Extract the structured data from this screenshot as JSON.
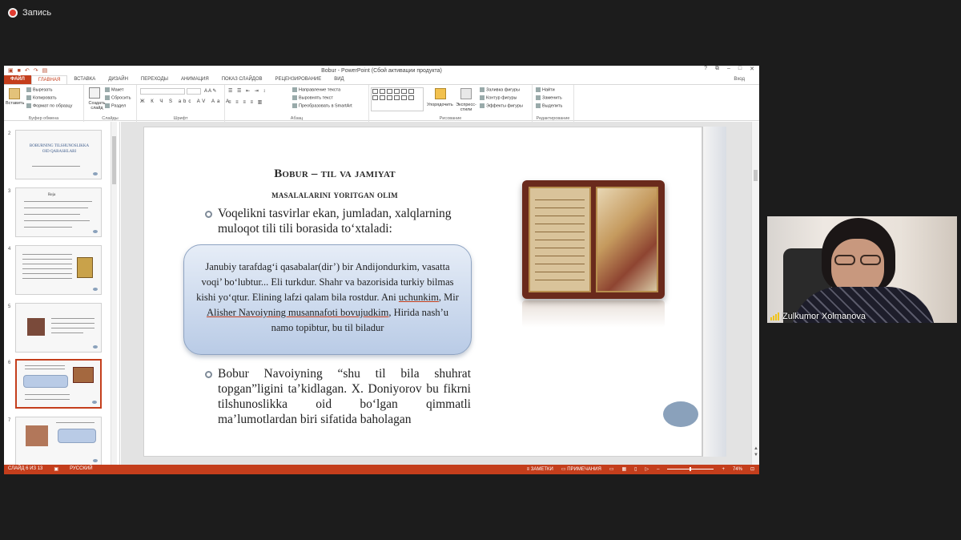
{
  "recording": {
    "label": "Запись"
  },
  "window": {
    "title": "Bobur - PowerPoint (Сбой активации продукта)",
    "controls": [
      "?",
      "⧉",
      "–",
      "□",
      "✕"
    ],
    "signin": "Вход"
  },
  "ribbon": {
    "tabs": [
      "ФАЙЛ",
      "ГЛАВНАЯ",
      "ВСТАВКА",
      "ДИЗАЙН",
      "ПЕРЕХОДЫ",
      "АНИМАЦИЯ",
      "ПОКАЗ СЛАЙДОВ",
      "РЕЦЕНЗИРОВАНИЕ",
      "ВИД"
    ],
    "clipboard": {
      "paste": "Вставить",
      "cut": "Вырезать",
      "copy": "Копировать",
      "format": "Формат по образцу",
      "label": "Буфер обмена"
    },
    "slides": {
      "new": "Создать слайд",
      "layout": "Макет",
      "reset": "Сбросить",
      "section": "Раздел",
      "label": "Слайды"
    },
    "font": {
      "label": "Шрифт"
    },
    "paragraph": {
      "direction": "Направление текста",
      "align": "Выровнять текст",
      "smartart": "Преобразовать в SmartArt",
      "label": "Абзац"
    },
    "drawing": {
      "arrange": "Упорядочить",
      "styles": "Экспресс-стили",
      "fill": "Заливка фигуры",
      "outline": "Контур фигуры",
      "effects": "Эффекты фигуры",
      "label": "Рисование"
    },
    "editing": {
      "find": "Найти",
      "replace": "Заменить",
      "select": "Выделить",
      "label": "Редактирование"
    }
  },
  "thumbnails": [
    {
      "num": "2",
      "title": "BOBURNING TILSHUNOSLIKKA OID QARASHLARI"
    },
    {
      "num": "3",
      "title": "Reja"
    },
    {
      "num": "4",
      "title": ""
    },
    {
      "num": "5",
      "title": ""
    },
    {
      "num": "6",
      "title": ""
    },
    {
      "num": "7",
      "title": ""
    }
  ],
  "slide": {
    "title_line1": "Bobur – til va jamiyat",
    "title_line2": "masalalarini yoritgan olim",
    "bullet1": "Voqelikni tasvirlar ekan, jumladan, xalqlarning muloqot tili tili borasida to‘xtaladi:",
    "quote_part1": "Janubiy tarafdag‘i qasabalar(dir’) bir Andijondurkim, vasatta voqi’ bo‘lubtur... Eli turkdur. Shahr va bazorisida  turkiy bilmas kishi yo‘qtur. Elining lafzi qalam bila rostdur. Ani ",
    "quote_u1": "uchunkim",
    "quote_part2": ", Mir ",
    "quote_u2": "Alisher Navoiyning musannafoti bovujudkim",
    "quote_part3": ", Hirida nash’u namo topibtur, bu til biladur",
    "bullet2": "Bobur Navoiyning “shu til bila shuhrat topgan”ligini ta’kidlagan. X. Doniyorov bu fikrni tilshunoslikka oid bo‘lgan qimmatli ma’lumotlardan biri sifatida baholagan"
  },
  "status": {
    "slide_info": "СЛАЙД 6 ИЗ 13",
    "language": "РУССКИЙ",
    "notes": "ЗАМЕТКИ",
    "comments": "ПРИМЕЧАНИЯ",
    "zoom": "74%"
  },
  "participant": {
    "name": "Zulkumor Xolmanova"
  },
  "colors": {
    "accent": "#c43e1c",
    "quote_fill": "#b9cbe6",
    "oval": "#8aa1bb"
  }
}
